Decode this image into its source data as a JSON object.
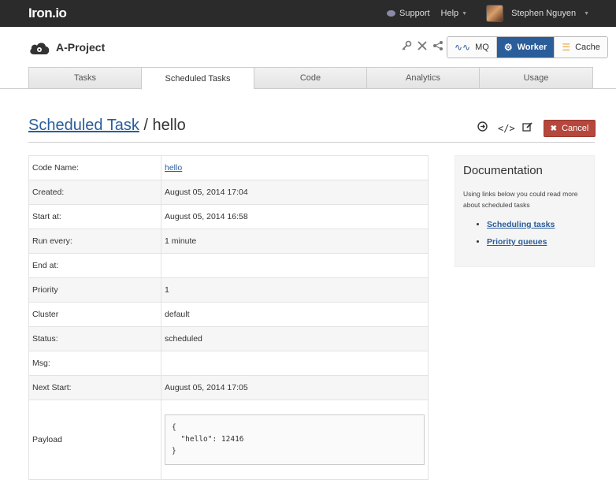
{
  "topbar": {
    "logo": "Iron.io",
    "support": "Support",
    "help": "Help",
    "user": "Stephen Nguyen"
  },
  "project": {
    "name": "A-Project",
    "services": [
      {
        "label": "MQ",
        "icon": "mq-icon",
        "active": false
      },
      {
        "label": "Worker",
        "icon": "gear-icon",
        "active": true
      },
      {
        "label": "Cache",
        "icon": "cache-icon",
        "active": false
      }
    ]
  },
  "tabs": [
    {
      "label": "Tasks",
      "active": false
    },
    {
      "label": "Scheduled Tasks",
      "active": true
    },
    {
      "label": "Code",
      "active": false
    },
    {
      "label": "Analytics",
      "active": false
    },
    {
      "label": "Usage",
      "active": false
    }
  ],
  "page": {
    "breadcrumb": "Scheduled Task",
    "separator": " / ",
    "name": "hello",
    "cancel_label": "Cancel"
  },
  "details": {
    "rows": [
      {
        "label": "Code Name:",
        "value": "hello",
        "link": true
      },
      {
        "label": "Created:",
        "value": "August 05, 2014 17:04"
      },
      {
        "label": "Start at:",
        "value": "August 05, 2014 16:58"
      },
      {
        "label": "Run every:",
        "value": "1 minute"
      },
      {
        "label": "End at:",
        "value": ""
      },
      {
        "label": "Priority",
        "value": "1"
      },
      {
        "label": "Cluster",
        "value": "default"
      },
      {
        "label": "Status:",
        "value": "scheduled"
      },
      {
        "label": "Msg:",
        "value": ""
      },
      {
        "label": "Next Start:",
        "value": "August 05, 2014 17:05"
      }
    ],
    "payload_label": "Payload",
    "payload": "{\n  \"hello\": 12416\n}"
  },
  "docs": {
    "title": "Documentation",
    "text": "Using links below you could read more about scheduled tasks",
    "links": [
      "Scheduling tasks",
      "Priority queues"
    ]
  },
  "colors": {
    "topbar": "#2b2b2b",
    "accent": "#2a5d9a",
    "cancel": "#b5473d"
  }
}
